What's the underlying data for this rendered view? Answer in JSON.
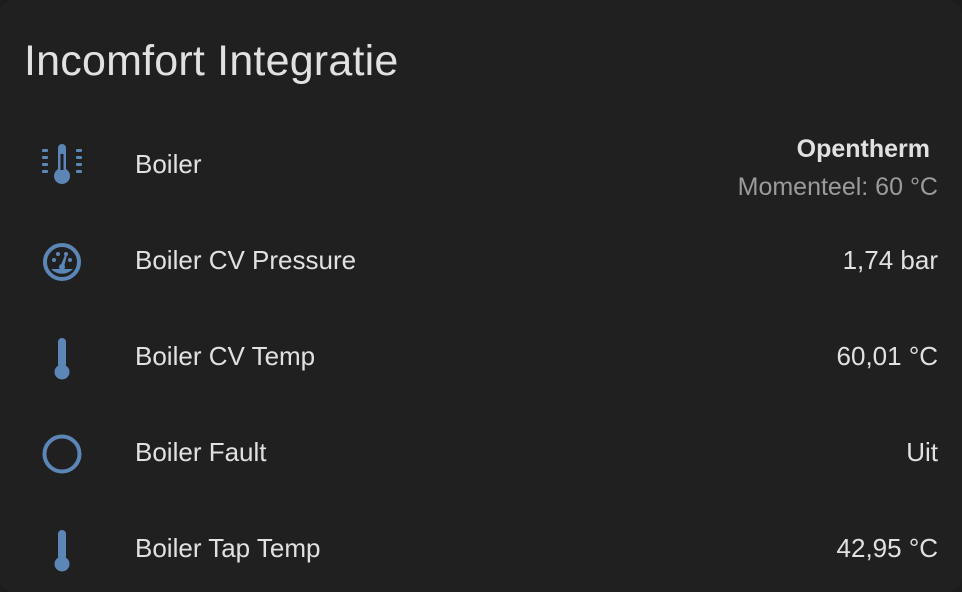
{
  "card": {
    "title": "Incomfort Integratie"
  },
  "colors": {
    "icon": "#5b86b6",
    "primary_text": "#e1e1e1",
    "secondary_text": "#9b9b9b",
    "card_background": "#202020"
  },
  "entities": [
    {
      "icon": "thermostat-icon",
      "name": "Boiler",
      "state": "Opentherm",
      "secondary": "Momenteel: 60 °C"
    },
    {
      "icon": "gauge-icon",
      "name": "Boiler CV Pressure",
      "state": "1,74 bar"
    },
    {
      "icon": "thermometer-icon",
      "name": "Boiler CV Temp",
      "state": "60,01 °C"
    },
    {
      "icon": "circle-outline-icon",
      "name": "Boiler Fault",
      "state": "Uit"
    },
    {
      "icon": "thermometer-icon",
      "name": "Boiler Tap Temp",
      "state": "42,95 °C"
    }
  ]
}
